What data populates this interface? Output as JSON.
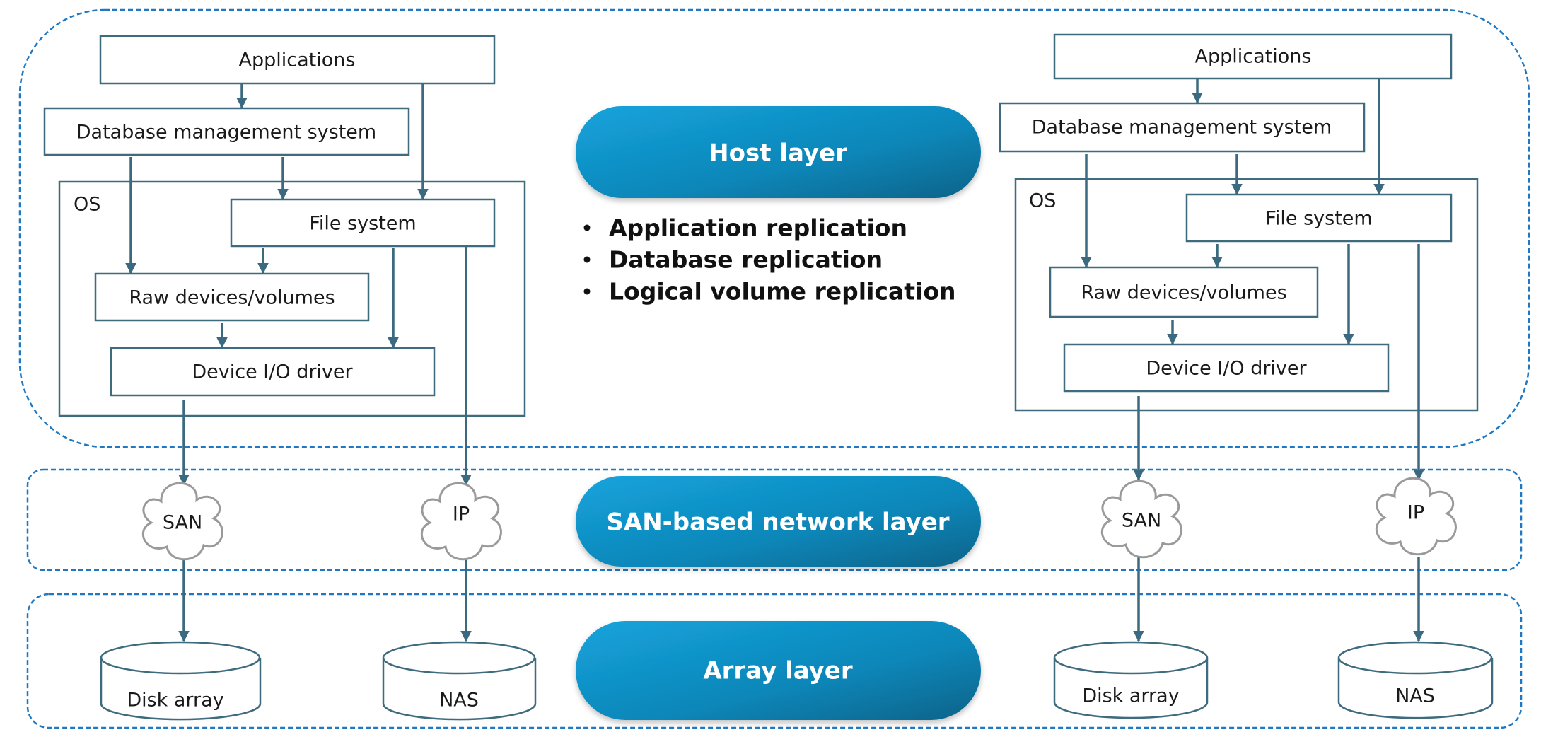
{
  "colors": {
    "accent": "#1296cf",
    "line": "#3b6a80",
    "dashed_border": "#1f78c1"
  },
  "layers": {
    "host": "Host layer",
    "network": "SAN-based network layer",
    "array": "Array layer"
  },
  "host_bullets": [
    "Application replication",
    "Database replication",
    "Logical volume replication"
  ],
  "host_stack": {
    "applications": "Applications",
    "dbms": "Database management system",
    "os": "OS",
    "file_system": "File system",
    "raw_devices": "Raw devices/volumes",
    "device_driver": "Device I/O driver"
  },
  "network": {
    "san": "SAN",
    "ip": "IP"
  },
  "storage": {
    "disk_array": "Disk array",
    "nas": "NAS"
  },
  "icons": {
    "cloud": "cloud-icon",
    "cylinder": "storage-cylinder-icon"
  }
}
